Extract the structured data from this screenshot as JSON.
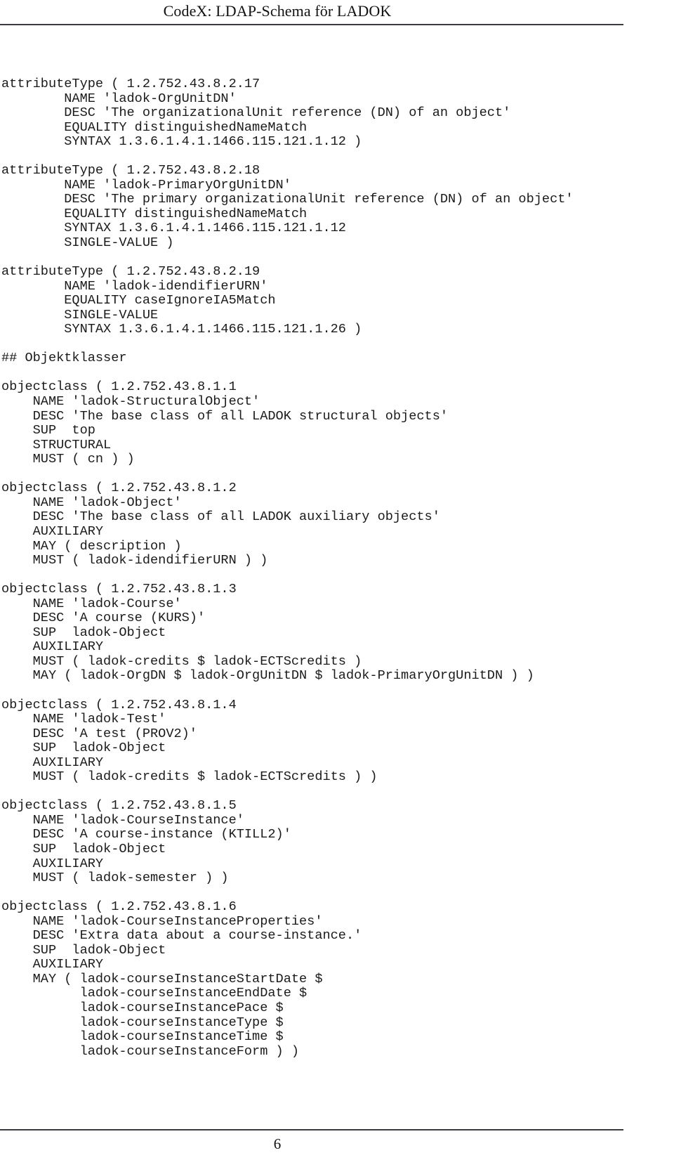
{
  "document": {
    "kind": "pdf-page",
    "header_title": "CodeX: LDAP-Schema för LADOK",
    "page_number": "6"
  },
  "rules": {
    "color": "#3a3a42",
    "top_rule": true,
    "bottom_rule": true
  },
  "body": {
    "text": "attributeType ( 1.2.752.43.8.2.17\n        NAME 'ladok-OrgUnitDN'\n        DESC 'The organizationalUnit reference (DN) of an object'\n        EQUALITY distinguishedNameMatch\n        SYNTAX 1.3.6.1.4.1.1466.115.121.1.12 )\n\nattributeType ( 1.2.752.43.8.2.18\n        NAME 'ladok-PrimaryOrgUnitDN'\n        DESC 'The primary organizationalUnit reference (DN) of an object'\n        EQUALITY distinguishedNameMatch\n        SYNTAX 1.3.6.1.4.1.1466.115.121.1.12\n        SINGLE-VALUE )\n\nattributeType ( 1.2.752.43.8.2.19\n        NAME 'ladok-idendifierURN'\n        EQUALITY caseIgnoreIA5Match\n        SINGLE-VALUE\n        SYNTAX 1.3.6.1.4.1.1466.115.121.1.26 )\n\n## Objektklasser\n\nobjectclass ( 1.2.752.43.8.1.1\n    NAME 'ladok-StructuralObject'\n    DESC 'The base class of all LADOK structural objects'\n    SUP  top\n    STRUCTURAL\n    MUST ( cn ) )\n\nobjectclass ( 1.2.752.43.8.1.2\n    NAME 'ladok-Object'\n    DESC 'The base class of all LADOK auxiliary objects'\n    AUXILIARY\n    MAY ( description )\n    MUST ( ladok-idendifierURN ) )\n\nobjectclass ( 1.2.752.43.8.1.3\n    NAME 'ladok-Course'\n    DESC 'A course (KURS)'\n    SUP  ladok-Object\n    AUXILIARY\n    MUST ( ladok-credits $ ladok-ECTScredits )\n    MAY ( ladok-OrgDN $ ladok-OrgUnitDN $ ladok-PrimaryOrgUnitDN ) )\n\nobjectclass ( 1.2.752.43.8.1.4\n    NAME 'ladok-Test'\n    DESC 'A test (PROV2)'\n    SUP  ladok-Object\n    AUXILIARY\n    MUST ( ladok-credits $ ladok-ECTScredits ) )\n\nobjectclass ( 1.2.752.43.8.1.5\n    NAME 'ladok-CourseInstance'\n    DESC 'A course-instance (KTILL2)'\n    SUP  ladok-Object\n    AUXILIARY\n    MUST ( ladok-semester ) )\n\nobjectclass ( 1.2.752.43.8.1.6\n    NAME 'ladok-CourseInstanceProperties'\n    DESC 'Extra data about a course-instance.'\n    SUP  ladok-Object\n    AUXILIARY\n    MAY ( ladok-courseInstanceStartDate $\n          ladok-courseInstanceEndDate $\n          ladok-courseInstancePace $\n          ladok-courseInstanceType $\n          ladok-courseInstanceTime $\n          ladok-courseInstanceForm ) )",
    "sections": [
      {
        "kind": "attributeType",
        "oid": "1.2.752.43.8.2.17",
        "header": "attributeType ( 1.2.752.43.8.2.17",
        "lines": [
          "NAME 'ladok-OrgUnitDN'",
          "DESC 'The organizationalUnit reference (DN) of an object'",
          "EQUALITY distinguishedNameMatch",
          "SYNTAX 1.3.6.1.4.1.1466.115.121.1.12 )"
        ]
      },
      {
        "kind": "attributeType",
        "oid": "1.2.752.43.8.2.18",
        "header": "attributeType ( 1.2.752.43.8.2.18",
        "lines": [
          "NAME 'ladok-PrimaryOrgUnitDN'",
          "DESC 'The primary organizationalUnit reference (DN) of an object'",
          "EQUALITY distinguishedNameMatch",
          "SYNTAX 1.3.6.1.4.1.1466.115.121.1.12",
          "SINGLE-VALUE )"
        ]
      },
      {
        "kind": "attributeType",
        "oid": "1.2.752.43.8.2.19",
        "header": "attributeType ( 1.2.752.43.8.2.19",
        "lines": [
          "NAME 'ladok-idendifierURN'",
          "EQUALITY caseIgnoreIA5Match",
          "SINGLE-VALUE",
          "SYNTAX 1.3.6.1.4.1.1466.115.121.1.26 )"
        ]
      },
      {
        "kind": "comment",
        "header": "## Objektklasser",
        "lines": []
      },
      {
        "kind": "objectclass",
        "oid": "1.2.752.43.8.1.1",
        "header": "objectclass ( 1.2.752.43.8.1.1",
        "lines": [
          "NAME 'ladok-StructuralObject'",
          "DESC 'The base class of all LADOK structural objects'",
          "SUP  top",
          "STRUCTURAL",
          "MUST ( cn ) )"
        ]
      },
      {
        "kind": "objectclass",
        "oid": "1.2.752.43.8.1.2",
        "header": "objectclass ( 1.2.752.43.8.1.2",
        "lines": [
          "NAME 'ladok-Object'",
          "DESC 'The base class of all LADOK auxiliary objects'",
          "AUXILIARY",
          "MAY ( description )",
          "MUST ( ladok-idendifierURN ) )"
        ]
      },
      {
        "kind": "objectclass",
        "oid": "1.2.752.43.8.1.3",
        "header": "objectclass ( 1.2.752.43.8.1.3",
        "lines": [
          "NAME 'ladok-Course'",
          "DESC 'A course (KURS)'",
          "SUP  ladok-Object",
          "AUXILIARY",
          "MUST ( ladok-credits $ ladok-ECTScredits )",
          "MAY ( ladok-OrgDN $ ladok-OrgUnitDN $ ladok-PrimaryOrgUnitDN ) )"
        ]
      },
      {
        "kind": "objectclass",
        "oid": "1.2.752.43.8.1.4",
        "header": "objectclass ( 1.2.752.43.8.1.4",
        "lines": [
          "NAME 'ladok-Test'",
          "DESC 'A test (PROV2)'",
          "SUP  ladok-Object",
          "AUXILIARY",
          "MUST ( ladok-credits $ ladok-ECTScredits ) )"
        ]
      },
      {
        "kind": "objectclass",
        "oid": "1.2.752.43.8.1.5",
        "header": "objectclass ( 1.2.752.43.8.1.5",
        "lines": [
          "NAME 'ladok-CourseInstance'",
          "DESC 'A course-instance (KTILL2)'",
          "SUP  ladok-Object",
          "AUXILIARY",
          "MUST ( ladok-semester ) )"
        ]
      },
      {
        "kind": "objectclass",
        "oid": "1.2.752.43.8.1.6",
        "header": "objectclass ( 1.2.752.43.8.1.6",
        "lines": [
          "NAME 'ladok-CourseInstanceProperties'",
          "DESC 'Extra data about a course-instance.'",
          "SUP  ladok-Object",
          "AUXILIARY",
          "MAY ( ladok-courseInstanceStartDate $",
          "      ladok-courseInstanceEndDate $",
          "      ladok-courseInstancePace $",
          "      ladok-courseInstanceType $",
          "      ladok-courseInstanceTime $",
          "      ladok-courseInstanceForm ) )"
        ]
      }
    ]
  }
}
